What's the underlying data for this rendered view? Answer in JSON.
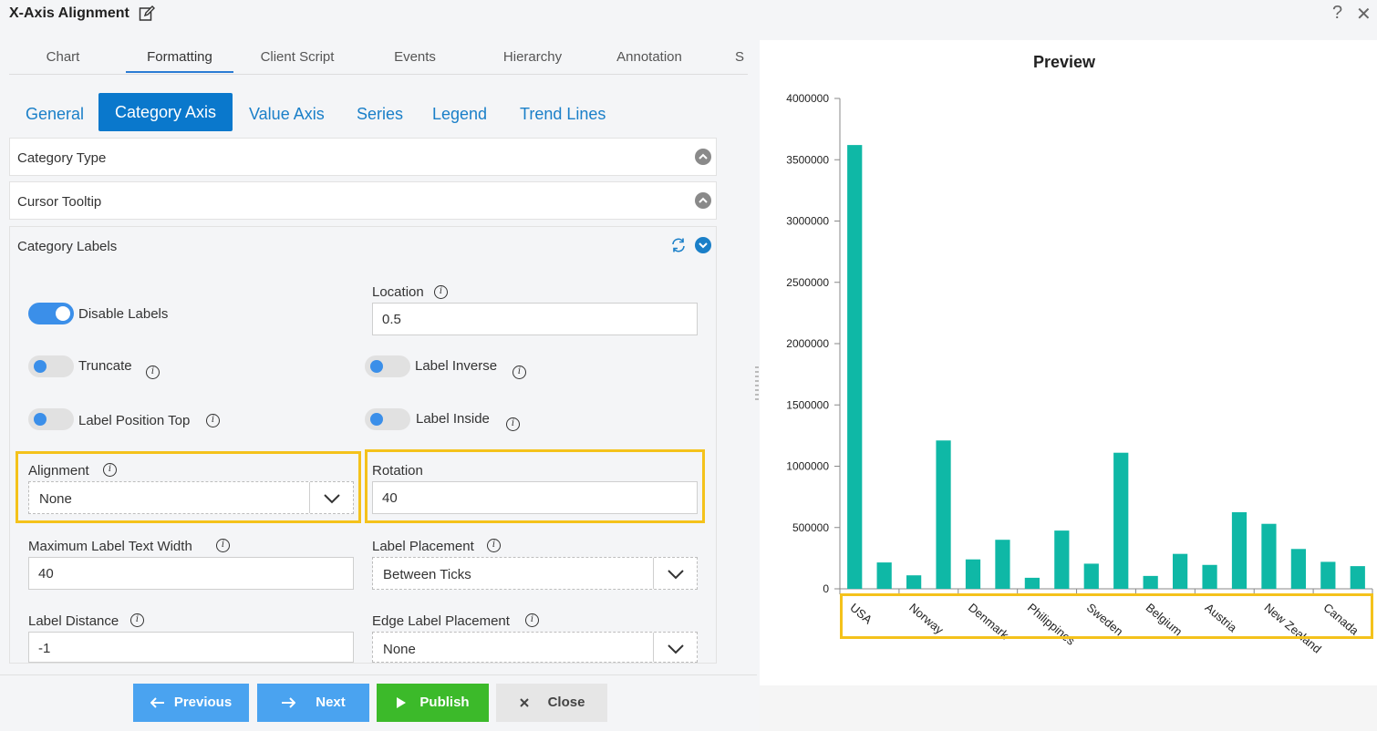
{
  "window": {
    "title": "X-Axis Alignment",
    "help": "?",
    "close": "✕"
  },
  "main_tabs": [
    {
      "label": "Chart"
    },
    {
      "label": "Formatting"
    },
    {
      "label": "Client Script"
    },
    {
      "label": "Events"
    },
    {
      "label": "Hierarchy"
    },
    {
      "label": "Annotation"
    },
    {
      "label": "S"
    }
  ],
  "sub_tabs": [
    {
      "label": "General"
    },
    {
      "label": "Category Axis"
    },
    {
      "label": "Value Axis"
    },
    {
      "label": "Series"
    },
    {
      "label": "Legend"
    },
    {
      "label": "Trend Lines"
    }
  ],
  "accordions": {
    "category_type": "Category Type",
    "cursor_tooltip": "Cursor Tooltip",
    "category_labels": "Category Labels"
  },
  "form": {
    "disable_labels": {
      "label": "Disable Labels",
      "on": true
    },
    "truncate": {
      "label": "Truncate",
      "on": false
    },
    "label_position_top": {
      "label": "Label Position Top",
      "on": false
    },
    "location": {
      "label": "Location",
      "value": "0.5"
    },
    "label_inverse": {
      "label": "Label Inverse",
      "on": false
    },
    "label_inside": {
      "label": "Label Inside",
      "on": false
    },
    "alignment": {
      "label": "Alignment",
      "value": "None"
    },
    "rotation": {
      "label": "Rotation",
      "value": "40"
    },
    "max_label_text_width": {
      "label": "Maximum Label Text Width",
      "value": "40"
    },
    "label_placement": {
      "label": "Label Placement",
      "value": "Between Ticks"
    },
    "label_distance": {
      "label": "Label Distance",
      "value": "-1"
    },
    "edge_label_placement": {
      "label": "Edge Label Placement",
      "value": "None"
    }
  },
  "footer": {
    "previous": "Previous",
    "next": "Next",
    "publish": "Publish",
    "close": "Close"
  },
  "colors": {
    "bar": "#0fb8a6",
    "primary": "#0a78cc",
    "button_blue": "#4aa3f0",
    "publish_green": "#3cba2a",
    "highlight": "#f4c21b"
  },
  "preview": {
    "title": "Preview",
    "chart_data": {
      "type": "bar",
      "ylim": [
        0,
        4000000
      ],
      "y_ticks": [
        "4000000",
        "3500000",
        "3000000",
        "2500000",
        "2000000",
        "1500000",
        "1000000",
        "500000",
        "0"
      ],
      "category_labels_shown": [
        "USA",
        "Norway",
        "Denmark",
        "Philippines",
        "Sweden",
        "Belgium",
        "Austria",
        "New Zealand",
        "Canada"
      ],
      "label_rotation": 40,
      "values": [
        3620000,
        215000,
        110000,
        1210000,
        240000,
        400000,
        90000,
        475000,
        205000,
        1110000,
        105000,
        285000,
        195000,
        625000,
        530000,
        325000,
        220000,
        185000
      ]
    }
  }
}
